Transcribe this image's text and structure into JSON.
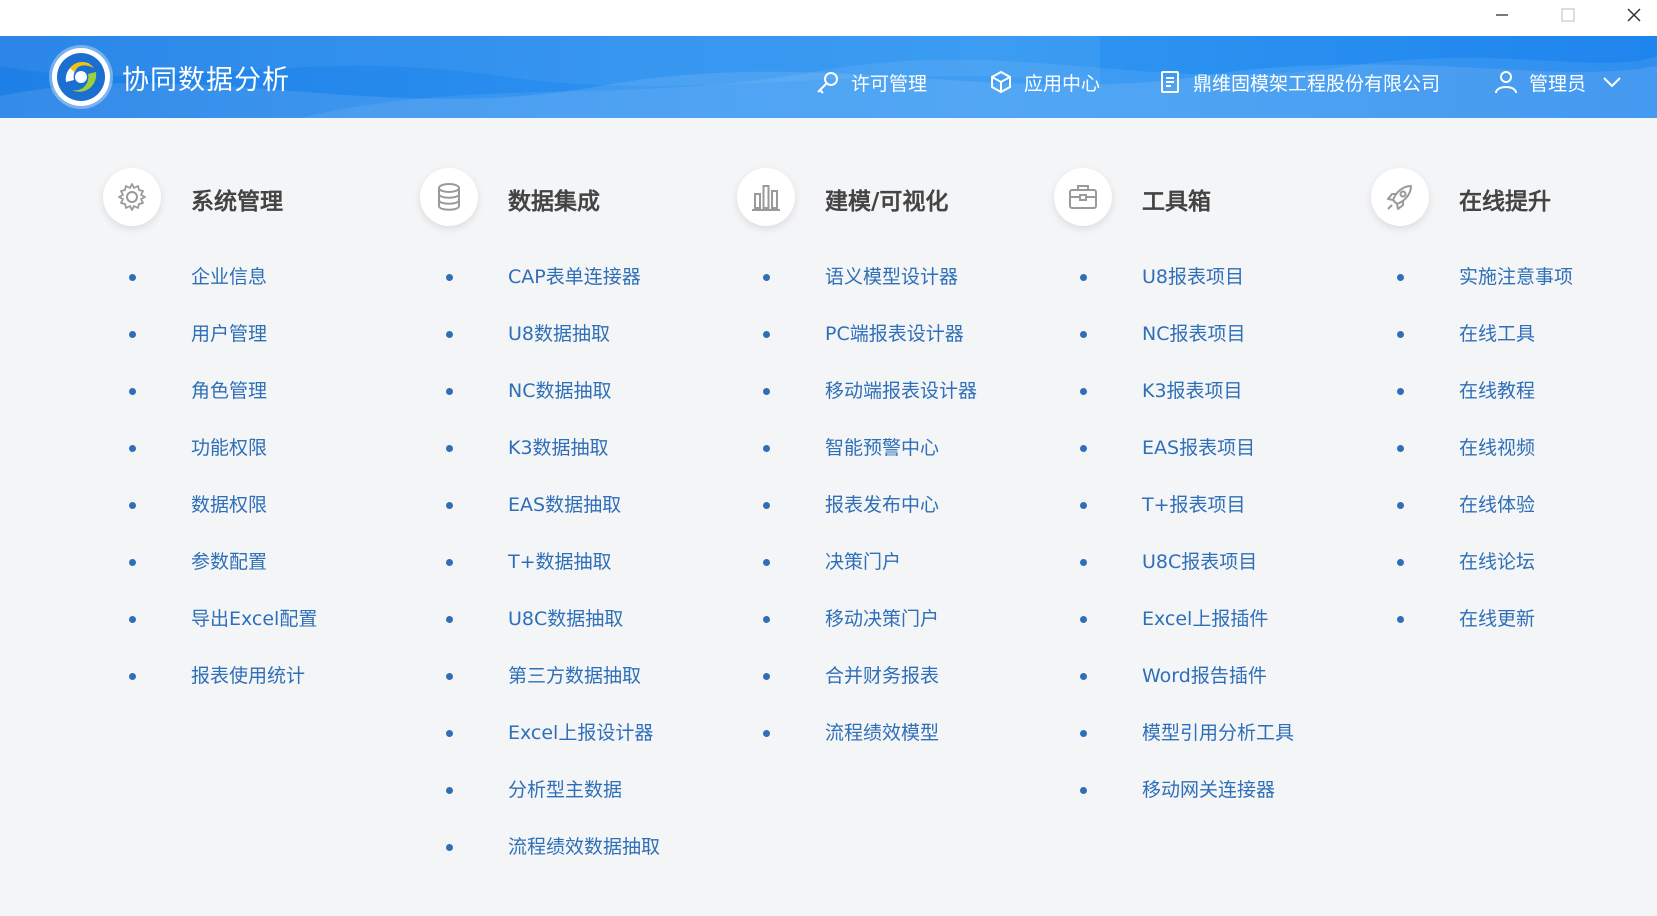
{
  "window": {
    "controls": [
      "minimize",
      "maximize",
      "close"
    ]
  },
  "header": {
    "title": "协同数据分析",
    "nav": [
      {
        "label": "许可管理",
        "icon": "key-icon"
      },
      {
        "label": "应用中心",
        "icon": "cube-icon"
      },
      {
        "label": "鼎维固模架工程股份有限公司",
        "icon": "document-icon"
      },
      {
        "label": "管理员",
        "icon": "user-icon"
      }
    ]
  },
  "columns": [
    {
      "title": "系统管理",
      "icon": "gear-icon",
      "items": [
        "企业信息",
        "用户管理",
        "角色管理",
        "功能权限",
        "数据权限",
        "参数配置",
        "导出Excel配置",
        "报表使用统计"
      ]
    },
    {
      "title": "数据集成",
      "icon": "database-icon",
      "items": [
        "CAP表单连接器",
        "U8数据抽取",
        "NC数据抽取",
        "K3数据抽取",
        "EAS数据抽取",
        "T+数据抽取",
        "U8C数据抽取",
        "第三方数据抽取",
        "Excel上报设计器",
        "分析型主数据",
        "流程绩效数据抽取"
      ]
    },
    {
      "title": "建模/可视化",
      "icon": "bar-chart-icon",
      "items": [
        "语义模型设计器",
        "PC端报表设计器",
        "移动端报表设计器",
        "智能预警中心",
        "报表发布中心",
        "决策门户",
        "移动决策门户",
        "合并财务报表",
        "流程绩效模型"
      ]
    },
    {
      "title": "工具箱",
      "icon": "toolbox-icon",
      "items": [
        "U8报表项目",
        "NC报表项目",
        "K3报表项目",
        "EAS报表项目",
        "T+报表项目",
        "U8C报表项目",
        "Excel上报插件",
        "Word报告插件",
        "模型引用分析工具",
        "移动网关连接器"
      ]
    },
    {
      "title": "在线提升",
      "icon": "rocket-icon",
      "items": [
        "实施注意事项",
        "在线工具",
        "在线教程",
        "在线视频",
        "在线体验",
        "在线论坛",
        "在线更新"
      ]
    }
  ],
  "colors": {
    "header_blue": "#2a8ff0",
    "link_blue": "#2f6fb8",
    "title_gray": "#444444",
    "background": "#f4f5f7"
  }
}
